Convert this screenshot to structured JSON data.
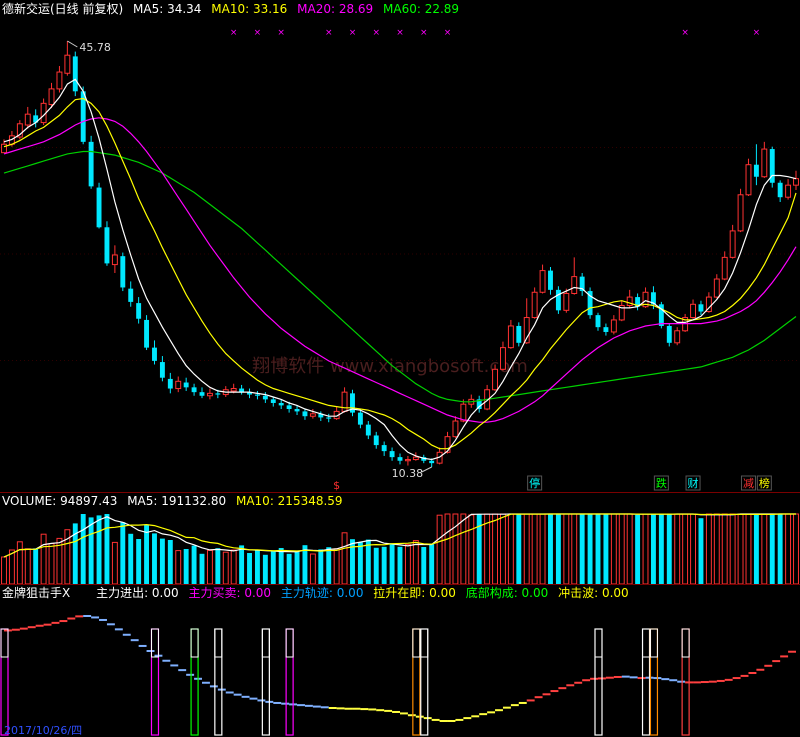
{
  "price_header": {
    "title": "德新交运(日线 前复权)",
    "ma5": "MA5: 34.34",
    "ma10": "MA10: 33.16",
    "ma20": "MA20: 28.69",
    "ma60": "MA60: 22.89",
    "colors": {
      "title": "#ffffff",
      "ma5": "#ffffff",
      "ma10": "#ffff00",
      "ma20": "#ff00ff",
      "ma60": "#00ff00"
    }
  },
  "volume_header": {
    "volume": "VOLUME: 94897.43",
    "ma5": "MA5: 191132.80",
    "ma10": "MA10: 215348.59"
  },
  "indicator_header": {
    "name": "金牌狙击手X",
    "items": [
      {
        "label": "主力进出: 0.00",
        "color": "#ffffff"
      },
      {
        "label": "主力买卖: 0.00",
        "color": "#ff00ff"
      },
      {
        "label": "主力轨迹: 0.00",
        "color": "#00a0ff"
      },
      {
        "label": "拉升在即: 0.00",
        "color": "#ffff00"
      },
      {
        "label": "底部构成: 0.00",
        "color": "#00ff00"
      },
      {
        "label": "冲击波: 0.00",
        "color": "#ffff00"
      }
    ]
  },
  "watermark": "翔博软件 www.xiangbosoft.com",
  "annotations": {
    "high_label": "45.78",
    "low_label": "10.38",
    "dollar": "$",
    "signals": [
      {
        "text": "停",
        "color": "#00ffff"
      },
      {
        "text": "跌",
        "color": "#00ff00"
      },
      {
        "text": "财",
        "color": "#00ffff"
      },
      {
        "text": "减",
        "color": "#ff3030"
      },
      {
        "text": "榜",
        "color": "#ffff00"
      }
    ]
  },
  "footer_date": "2017/10/26/四",
  "chart_data": {
    "type": "candlestick",
    "ylim": [
      10.38,
      45.78
    ],
    "high": 45.78,
    "low": 10.38,
    "ma_last": {
      "ma5": 34.34,
      "ma10": 33.16,
      "ma20": 28.69,
      "ma60": 22.89
    },
    "volume_last": {
      "volume": 94897.43,
      "ma5": 191132.8,
      "ma10": 215348.59
    },
    "candles": [
      [
        36.5,
        37.2,
        36.8,
        37.6
      ],
      [
        37.2,
        37.9,
        37.0,
        38.3
      ],
      [
        37.8,
        38.9,
        37.6,
        39.2
      ],
      [
        38.8,
        39.7,
        38.5,
        40.3
      ],
      [
        39.6,
        39.0,
        38.6,
        40.1
      ],
      [
        39.0,
        40.6,
        38.8,
        41.0
      ],
      [
        40.5,
        41.8,
        40.2,
        42.3
      ],
      [
        41.8,
        43.2,
        41.5,
        43.7
      ],
      [
        43.1,
        44.6,
        42.9,
        45.78
      ],
      [
        44.5,
        41.6,
        41.2,
        44.9
      ],
      [
        41.6,
        37.4,
        37.2,
        42.0
      ],
      [
        37.4,
        33.7,
        33.5,
        37.9
      ],
      [
        33.6,
        30.3,
        30.2,
        34.0
      ],
      [
        30.3,
        27.3,
        27.1,
        30.8
      ],
      [
        27.2,
        28.0,
        26.5,
        28.8
      ],
      [
        27.9,
        25.3,
        25.0,
        28.2
      ],
      [
        25.2,
        24.1,
        23.7,
        25.8
      ],
      [
        24.0,
        22.7,
        22.3,
        24.5
      ],
      [
        22.6,
        20.3,
        20.1,
        23.0
      ],
      [
        20.3,
        19.2,
        18.9,
        20.9
      ],
      [
        19.1,
        17.8,
        17.5,
        19.6
      ],
      [
        17.7,
        16.9,
        16.5,
        18.2
      ],
      [
        16.9,
        17.5,
        16.6,
        17.9
      ],
      [
        17.4,
        17.0,
        16.7,
        17.8
      ],
      [
        17.0,
        16.6,
        16.3,
        17.3
      ],
      [
        16.6,
        16.3,
        16.1,
        17.0
      ],
      [
        16.3,
        16.5,
        16.0,
        16.9
      ],
      [
        16.5,
        16.4,
        16.1,
        16.8
      ],
      [
        16.4,
        16.8,
        16.2,
        17.1
      ],
      [
        16.7,
        16.9,
        16.5,
        17.3
      ],
      [
        16.9,
        16.6,
        16.4,
        17.2
      ],
      [
        16.6,
        16.4,
        16.1,
        16.9
      ],
      [
        16.4,
        16.3,
        16.0,
        16.7
      ],
      [
        16.3,
        16.0,
        15.7,
        16.6
      ],
      [
        16.0,
        15.7,
        15.4,
        16.2
      ],
      [
        15.7,
        15.5,
        15.2,
        16.0
      ],
      [
        15.5,
        15.2,
        14.9,
        15.8
      ],
      [
        15.2,
        15.0,
        14.7,
        15.5
      ],
      [
        15.0,
        14.6,
        14.3,
        15.2
      ],
      [
        14.6,
        14.8,
        14.4,
        15.2
      ],
      [
        14.8,
        14.5,
        14.2,
        15.0
      ],
      [
        14.5,
        14.4,
        14.1,
        14.8
      ],
      [
        14.4,
        15.0,
        14.3,
        15.4
      ],
      [
        15.0,
        16.6,
        14.9,
        17.0
      ],
      [
        16.5,
        14.9,
        14.6,
        16.8
      ],
      [
        14.9,
        13.9,
        13.6,
        15.2
      ],
      [
        13.9,
        13.0,
        12.7,
        14.2
      ],
      [
        13.0,
        12.2,
        11.9,
        13.3
      ],
      [
        12.2,
        11.7,
        11.3,
        12.5
      ],
      [
        11.7,
        11.2,
        10.9,
        12.0
      ],
      [
        11.2,
        10.9,
        10.6,
        11.5
      ],
      [
        10.9,
        11.0,
        10.5,
        11.3
      ],
      [
        11.0,
        11.2,
        10.9,
        11.6
      ],
      [
        11.2,
        10.9,
        10.7,
        11.4
      ],
      [
        10.9,
        10.7,
        10.38,
        11.1
      ],
      [
        10.7,
        11.6,
        10.6,
        12.0
      ],
      [
        11.6,
        12.9,
        11.5,
        13.3
      ],
      [
        12.9,
        14.2,
        12.8,
        14.6
      ],
      [
        14.2,
        15.6,
        14.1,
        16.0
      ],
      [
        15.6,
        16.0,
        15.3,
        16.4
      ],
      [
        16.0,
        15.2,
        14.9,
        16.3
      ],
      [
        15.2,
        16.8,
        15.1,
        17.2
      ],
      [
        16.8,
        18.5,
        16.7,
        18.9
      ],
      [
        18.5,
        20.3,
        18.4,
        20.8
      ],
      [
        20.3,
        22.1,
        20.2,
        22.6
      ],
      [
        22.1,
        20.7,
        20.4,
        22.4
      ],
      [
        20.7,
        22.8,
        20.6,
        24.4
      ],
      [
        22.8,
        24.9,
        22.7,
        25.3
      ],
      [
        24.9,
        26.7,
        24.8,
        27.2
      ],
      [
        26.7,
        25.1,
        24.7,
        27.0
      ],
      [
        25.1,
        23.4,
        23.1,
        25.4
      ],
      [
        23.4,
        24.8,
        23.2,
        25.2
      ],
      [
        24.8,
        26.2,
        24.7,
        27.8
      ],
      [
        26.2,
        25.0,
        24.6,
        26.5
      ],
      [
        25.0,
        23.0,
        22.7,
        25.3
      ],
      [
        23.0,
        22.0,
        21.7,
        23.2
      ],
      [
        22.0,
        21.6,
        21.3,
        22.3
      ],
      [
        21.6,
        22.6,
        21.4,
        23.0
      ],
      [
        22.6,
        23.8,
        22.5,
        24.2
      ],
      [
        23.8,
        24.5,
        23.6,
        25.1
      ],
      [
        24.5,
        23.7,
        23.4,
        24.8
      ],
      [
        23.7,
        24.9,
        23.6,
        25.3
      ],
      [
        24.9,
        23.9,
        23.5,
        25.4
      ],
      [
        23.9,
        22.1,
        21.9,
        24.1
      ],
      [
        22.1,
        20.7,
        20.4,
        22.3
      ],
      [
        20.7,
        21.7,
        20.5,
        22.0
      ],
      [
        21.7,
        22.8,
        21.6,
        23.1
      ],
      [
        22.8,
        23.9,
        22.7,
        24.3
      ],
      [
        23.9,
        23.3,
        23.0,
        24.2
      ],
      [
        23.3,
        24.5,
        23.2,
        24.9
      ],
      [
        24.5,
        26.0,
        24.4,
        26.4
      ],
      [
        26.0,
        27.8,
        25.9,
        28.3
      ],
      [
        27.8,
        30.0,
        27.7,
        30.5
      ],
      [
        30.0,
        33.0,
        29.9,
        33.5
      ],
      [
        33.0,
        35.5,
        32.9,
        36.0
      ],
      [
        35.5,
        34.5,
        33.8,
        37.2
      ],
      [
        34.5,
        36.8,
        34.4,
        37.4
      ],
      [
        36.8,
        34.0,
        33.6,
        37.0
      ],
      [
        34.0,
        32.8,
        32.4,
        34.2
      ],
      [
        32.8,
        33.8,
        32.6,
        34.3
      ],
      [
        33.8,
        34.34,
        33.4,
        35.0
      ]
    ],
    "ma5": [
      37.4,
      37.6,
      38.0,
      38.6,
      39.0,
      39.6,
      40.3,
      41.1,
      42.2,
      42.6,
      41.6,
      39.9,
      37.7,
      35.1,
      32.4,
      30.1,
      28.0,
      26.0,
      24.4,
      23.2,
      22.0,
      20.9,
      19.8,
      18.8,
      18.1,
      17.5,
      17.0,
      16.7,
      16.6,
      16.6,
      16.6,
      16.6,
      16.5,
      16.4,
      16.2,
      16.0,
      15.7,
      15.5,
      15.2,
      15.0,
      14.8,
      14.6,
      14.6,
      15.0,
      15.2,
      15.1,
      14.8,
      14.4,
      13.9,
      13.0,
      12.2,
      11.6,
      11.3,
      11.1,
      11.0,
      11.2,
      11.7,
      12.6,
      13.7,
      14.7,
      15.4,
      15.9,
      16.5,
      17.5,
      18.7,
      19.8,
      21.1,
      22.2,
      23.6,
      24.3,
      24.7,
      25.0,
      25.3,
      25.2,
      24.6,
      24.2,
      24.0,
      23.8,
      23.6,
      23.6,
      23.7,
      24.2,
      24.0,
      23.5,
      22.9,
      22.4,
      22.4,
      22.6,
      22.9,
      23.6,
      24.3,
      25.2,
      26.5,
      28.2,
      30.1,
      32.2,
      33.8,
      34.6,
      34.6,
      34.5,
      34.34
    ],
    "ma10": [
      37.0,
      37.2,
      37.5,
      37.9,
      38.3,
      38.6,
      39.1,
      39.6,
      40.3,
      40.9,
      41.0,
      40.6,
      39.9,
      38.7,
      37.3,
      35.8,
      34.3,
      32.7,
      31.3,
      30.0,
      28.6,
      27.3,
      26.0,
      24.7,
      23.6,
      22.5,
      21.5,
      20.6,
      19.8,
      19.2,
      18.6,
      18.1,
      17.6,
      17.2,
      16.9,
      16.7,
      16.5,
      16.3,
      16.1,
      15.9,
      15.7,
      15.5,
      15.4,
      15.3,
      15.3,
      15.2,
      15.1,
      14.9,
      14.7,
      14.4,
      14.0,
      13.5,
      13.1,
      12.7,
      12.2,
      11.9,
      11.9,
      12.2,
      12.7,
      13.2,
      13.8,
      14.3,
      14.9,
      15.6,
      16.3,
      16.9,
      17.6,
      18.5,
      19.3,
      20.2,
      21.0,
      21.8,
      22.5,
      23.2,
      23.6,
      23.7,
      23.9,
      24.1,
      24.2,
      24.0,
      23.8,
      23.9,
      23.8,
      23.5,
      23.2,
      22.8,
      22.6,
      22.6,
      22.7,
      22.8,
      23.0,
      23.3,
      23.8,
      24.4,
      25.2,
      26.1,
      27.2,
      28.5,
      29.8,
      31.1,
      33.16
    ],
    "ma20": [
      36.4,
      36.6,
      36.8,
      37.0,
      37.2,
      37.4,
      37.7,
      38.0,
      38.4,
      38.8,
      39.1,
      39.3,
      39.4,
      39.3,
      39.1,
      38.7,
      38.1,
      37.4,
      36.6,
      35.7,
      34.8,
      33.8,
      32.8,
      31.8,
      30.8,
      29.8,
      28.8,
      27.9,
      27.0,
      26.1,
      25.3,
      24.5,
      23.8,
      23.1,
      22.5,
      21.9,
      21.4,
      20.9,
      20.4,
      20.0,
      19.6,
      19.2,
      18.9,
      18.6,
      18.3,
      18.0,
      17.7,
      17.4,
      17.1,
      16.8,
      16.5,
      16.2,
      15.9,
      15.6,
      15.3,
      15.0,
      14.7,
      14.5,
      14.3,
      14.2,
      14.1,
      14.1,
      14.2,
      14.4,
      14.7,
      15.0,
      15.4,
      15.8,
      16.3,
      16.9,
      17.5,
      18.1,
      18.7,
      19.3,
      19.8,
      20.3,
      20.7,
      21.1,
      21.4,
      21.7,
      21.9,
      22.1,
      22.2,
      22.3,
      22.3,
      22.3,
      22.3,
      22.3,
      22.3,
      22.4,
      22.5,
      22.7,
      23.0,
      23.3,
      23.7,
      24.2,
      24.9,
      25.7,
      26.6,
      27.6,
      28.69
    ],
    "ma60": [
      34.8,
      35.0,
      35.2,
      35.4,
      35.6,
      35.8,
      36.0,
      36.2,
      36.4,
      36.5,
      36.6,
      36.6,
      36.5,
      36.4,
      36.3,
      36.1,
      35.9,
      35.7,
      35.4,
      35.1,
      34.8,
      34.4,
      34.0,
      33.6,
      33.2,
      32.7,
      32.2,
      31.7,
      31.2,
      30.7,
      30.2,
      29.6,
      29.0,
      28.4,
      27.8,
      27.2,
      26.6,
      26.0,
      25.4,
      24.8,
      24.2,
      23.6,
      23.0,
      22.4,
      21.8,
      21.2,
      20.6,
      20.0,
      19.4,
      18.8,
      18.3,
      17.8,
      17.3,
      16.9,
      16.5,
      16.2,
      16.0,
      15.9,
      15.8,
      15.8,
      15.9,
      16.0,
      16.1,
      16.2,
      16.3,
      16.4,
      16.5,
      16.6,
      16.7,
      16.8,
      16.9,
      17.0,
      17.1,
      17.2,
      17.3,
      17.4,
      17.5,
      17.6,
      17.7,
      17.8,
      17.9,
      18.0,
      18.1,
      18.2,
      18.3,
      18.4,
      18.5,
      18.6,
      18.7,
      18.9,
      19.1,
      19.3,
      19.5,
      19.8,
      20.1,
      20.5,
      20.9,
      21.4,
      21.9,
      22.4,
      22.89
    ]
  }
}
